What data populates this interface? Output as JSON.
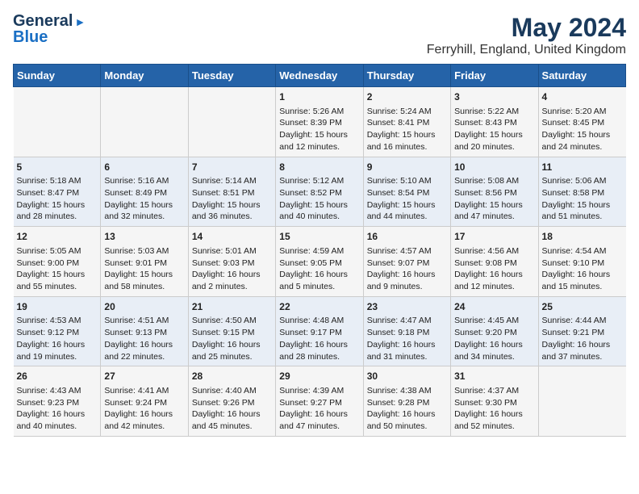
{
  "logo": {
    "general": "General",
    "blue": "Blue",
    "arrow_unicode": "▶"
  },
  "title": "May 2024",
  "subtitle": "Ferryhill, England, United Kingdom",
  "days_of_week": [
    "Sunday",
    "Monday",
    "Tuesday",
    "Wednesday",
    "Thursday",
    "Friday",
    "Saturday"
  ],
  "weeks": [
    {
      "cells": [
        {
          "day": "",
          "content": ""
        },
        {
          "day": "",
          "content": ""
        },
        {
          "day": "",
          "content": ""
        },
        {
          "day": "1",
          "content": "Sunrise: 5:26 AM\nSunset: 8:39 PM\nDaylight: 15 hours\nand 12 minutes."
        },
        {
          "day": "2",
          "content": "Sunrise: 5:24 AM\nSunset: 8:41 PM\nDaylight: 15 hours\nand 16 minutes."
        },
        {
          "day": "3",
          "content": "Sunrise: 5:22 AM\nSunset: 8:43 PM\nDaylight: 15 hours\nand 20 minutes."
        },
        {
          "day": "4",
          "content": "Sunrise: 5:20 AM\nSunset: 8:45 PM\nDaylight: 15 hours\nand 24 minutes."
        }
      ]
    },
    {
      "cells": [
        {
          "day": "5",
          "content": "Sunrise: 5:18 AM\nSunset: 8:47 PM\nDaylight: 15 hours\nand 28 minutes."
        },
        {
          "day": "6",
          "content": "Sunrise: 5:16 AM\nSunset: 8:49 PM\nDaylight: 15 hours\nand 32 minutes."
        },
        {
          "day": "7",
          "content": "Sunrise: 5:14 AM\nSunset: 8:51 PM\nDaylight: 15 hours\nand 36 minutes."
        },
        {
          "day": "8",
          "content": "Sunrise: 5:12 AM\nSunset: 8:52 PM\nDaylight: 15 hours\nand 40 minutes."
        },
        {
          "day": "9",
          "content": "Sunrise: 5:10 AM\nSunset: 8:54 PM\nDaylight: 15 hours\nand 44 minutes."
        },
        {
          "day": "10",
          "content": "Sunrise: 5:08 AM\nSunset: 8:56 PM\nDaylight: 15 hours\nand 47 minutes."
        },
        {
          "day": "11",
          "content": "Sunrise: 5:06 AM\nSunset: 8:58 PM\nDaylight: 15 hours\nand 51 minutes."
        }
      ]
    },
    {
      "cells": [
        {
          "day": "12",
          "content": "Sunrise: 5:05 AM\nSunset: 9:00 PM\nDaylight: 15 hours\nand 55 minutes."
        },
        {
          "day": "13",
          "content": "Sunrise: 5:03 AM\nSunset: 9:01 PM\nDaylight: 15 hours\nand 58 minutes."
        },
        {
          "day": "14",
          "content": "Sunrise: 5:01 AM\nSunset: 9:03 PM\nDaylight: 16 hours\nand 2 minutes."
        },
        {
          "day": "15",
          "content": "Sunrise: 4:59 AM\nSunset: 9:05 PM\nDaylight: 16 hours\nand 5 minutes."
        },
        {
          "day": "16",
          "content": "Sunrise: 4:57 AM\nSunset: 9:07 PM\nDaylight: 16 hours\nand 9 minutes."
        },
        {
          "day": "17",
          "content": "Sunrise: 4:56 AM\nSunset: 9:08 PM\nDaylight: 16 hours\nand 12 minutes."
        },
        {
          "day": "18",
          "content": "Sunrise: 4:54 AM\nSunset: 9:10 PM\nDaylight: 16 hours\nand 15 minutes."
        }
      ]
    },
    {
      "cells": [
        {
          "day": "19",
          "content": "Sunrise: 4:53 AM\nSunset: 9:12 PM\nDaylight: 16 hours\nand 19 minutes."
        },
        {
          "day": "20",
          "content": "Sunrise: 4:51 AM\nSunset: 9:13 PM\nDaylight: 16 hours\nand 22 minutes."
        },
        {
          "day": "21",
          "content": "Sunrise: 4:50 AM\nSunset: 9:15 PM\nDaylight: 16 hours\nand 25 minutes."
        },
        {
          "day": "22",
          "content": "Sunrise: 4:48 AM\nSunset: 9:17 PM\nDaylight: 16 hours\nand 28 minutes."
        },
        {
          "day": "23",
          "content": "Sunrise: 4:47 AM\nSunset: 9:18 PM\nDaylight: 16 hours\nand 31 minutes."
        },
        {
          "day": "24",
          "content": "Sunrise: 4:45 AM\nSunset: 9:20 PM\nDaylight: 16 hours\nand 34 minutes."
        },
        {
          "day": "25",
          "content": "Sunrise: 4:44 AM\nSunset: 9:21 PM\nDaylight: 16 hours\nand 37 minutes."
        }
      ]
    },
    {
      "cells": [
        {
          "day": "26",
          "content": "Sunrise: 4:43 AM\nSunset: 9:23 PM\nDaylight: 16 hours\nand 40 minutes."
        },
        {
          "day": "27",
          "content": "Sunrise: 4:41 AM\nSunset: 9:24 PM\nDaylight: 16 hours\nand 42 minutes."
        },
        {
          "day": "28",
          "content": "Sunrise: 4:40 AM\nSunset: 9:26 PM\nDaylight: 16 hours\nand 45 minutes."
        },
        {
          "day": "29",
          "content": "Sunrise: 4:39 AM\nSunset: 9:27 PM\nDaylight: 16 hours\nand 47 minutes."
        },
        {
          "day": "30",
          "content": "Sunrise: 4:38 AM\nSunset: 9:28 PM\nDaylight: 16 hours\nand 50 minutes."
        },
        {
          "day": "31",
          "content": "Sunrise: 4:37 AM\nSunset: 9:30 PM\nDaylight: 16 hours\nand 52 minutes."
        },
        {
          "day": "",
          "content": ""
        }
      ]
    }
  ]
}
